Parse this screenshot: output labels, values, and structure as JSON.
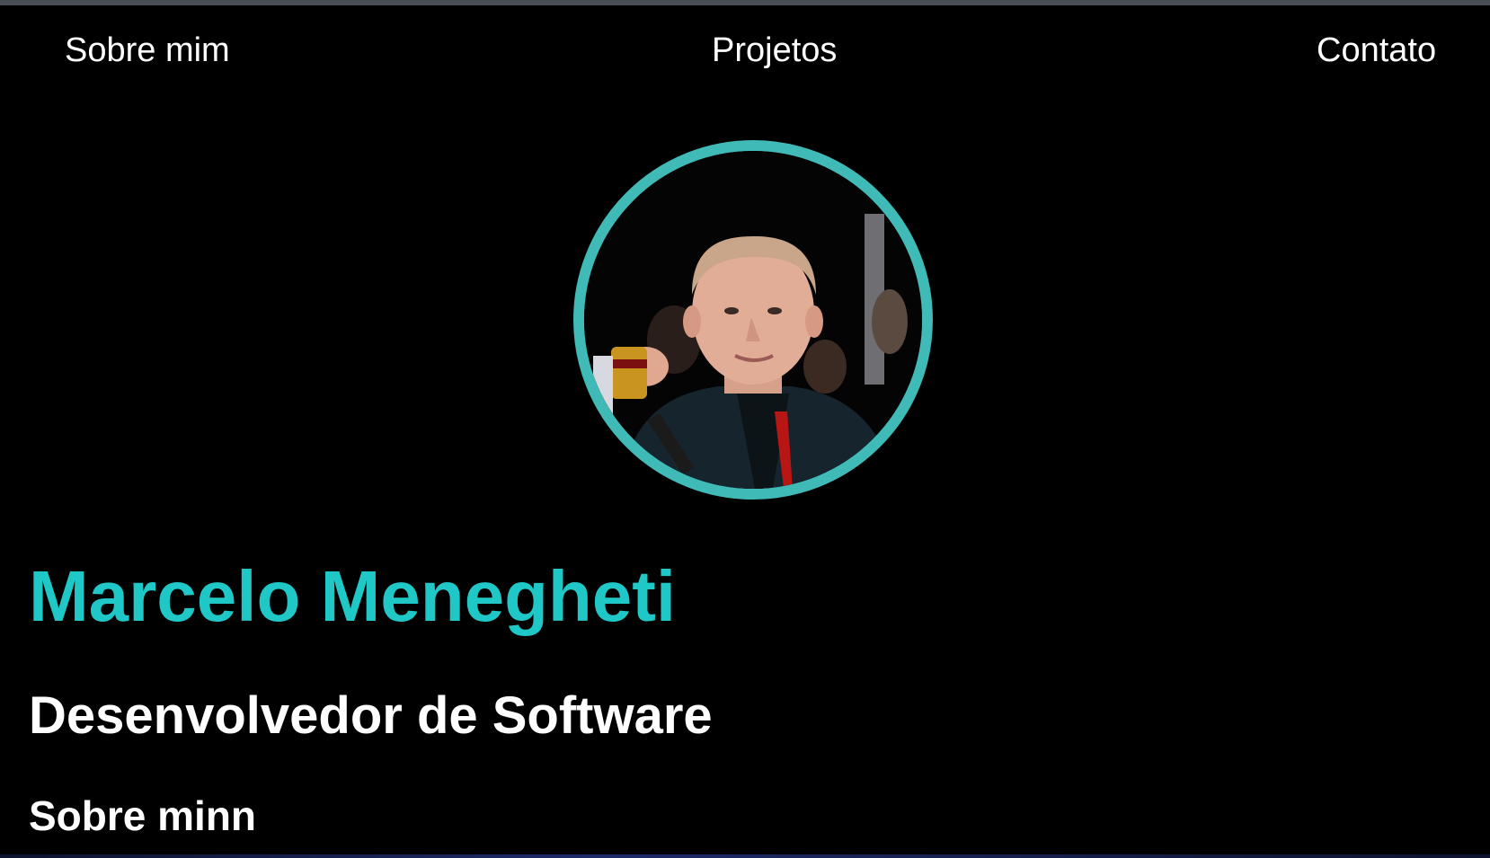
{
  "nav": {
    "items": [
      {
        "label": "Sobre mim"
      },
      {
        "label": "Projetos"
      },
      {
        "label": "Contato"
      }
    ]
  },
  "profile": {
    "name": "Marcelo Menegheti",
    "role": "Desenvolvedor de Software",
    "avatar_border_color": "#40bab7"
  },
  "section": {
    "title": "Sobre minn"
  },
  "colors": {
    "background": "#000000",
    "accent": "#1fc8c6",
    "text": "#ffffff"
  }
}
